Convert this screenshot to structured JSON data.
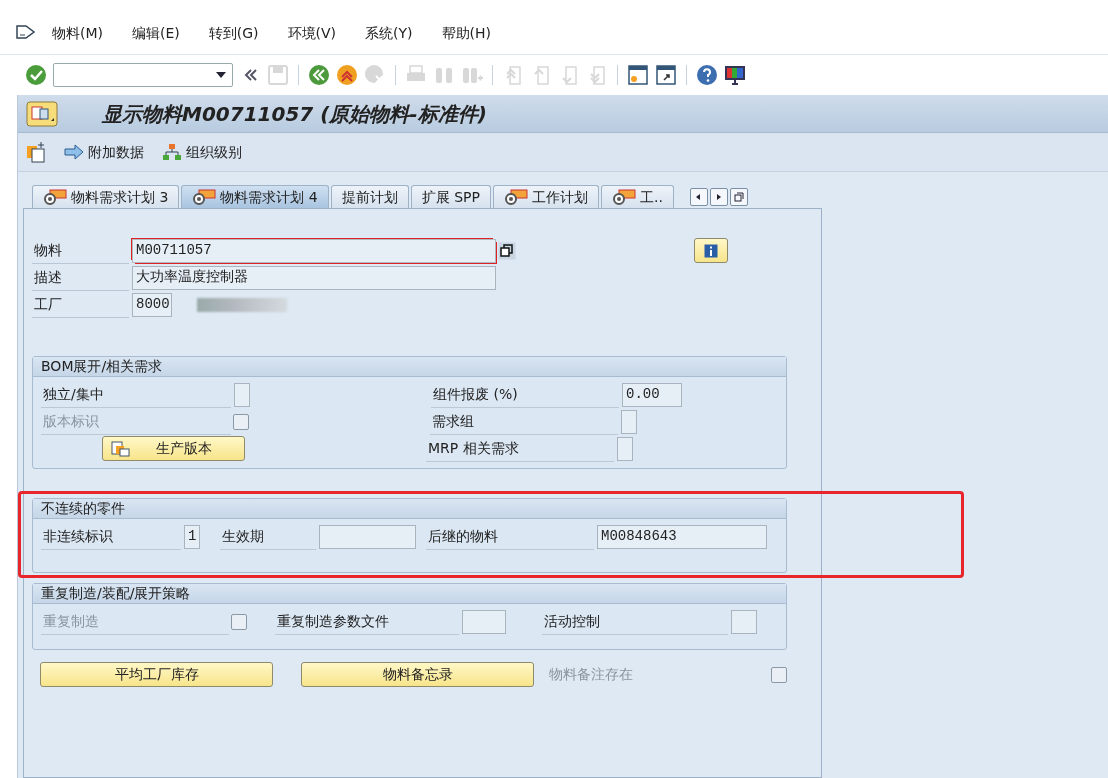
{
  "menu": [
    "物料(M)",
    "编辑(E)",
    "转到(G)",
    "环境(V)",
    "系统(Y)",
    "帮助(H)"
  ],
  "toolbar_groups": [
    [
      {
        "kind": "enter",
        "disabled": false
      },
      {
        "kind": "command-field",
        "disabled": false
      },
      {
        "kind": "collapse",
        "disabled": false
      },
      {
        "kind": "save",
        "disabled": true
      }
    ],
    [
      {
        "kind": "back",
        "disabled": false
      },
      {
        "kind": "exit",
        "disabled": false
      },
      {
        "kind": "cancel",
        "disabled": true
      }
    ],
    [
      {
        "kind": "print",
        "disabled": true
      },
      {
        "kind": "find",
        "disabled": true
      },
      {
        "kind": "find-next",
        "disabled": true
      }
    ],
    [
      {
        "kind": "first-page",
        "disabled": true
      },
      {
        "kind": "prev-page",
        "disabled": true
      },
      {
        "kind": "next-page",
        "disabled": true
      },
      {
        "kind": "last-page",
        "disabled": true
      }
    ],
    [
      {
        "kind": "new-session",
        "disabled": false
      },
      {
        "kind": "shortcut",
        "disabled": false
      }
    ],
    [
      {
        "kind": "help",
        "disabled": false
      },
      {
        "kind": "layout",
        "disabled": false
      }
    ]
  ],
  "title": "显示物料M00711057 (原始物料-标准件)",
  "app_toolbar": [
    {
      "kind": "create-doc"
    },
    {
      "kind": "arrow",
      "label": "附加数据"
    },
    {
      "kind": "org",
      "label": "组织级别"
    }
  ],
  "tabs": [
    {
      "label": "物料需求计划 3",
      "selected": false,
      "has_icon": true
    },
    {
      "label": "物料需求计划 4",
      "selected": true,
      "has_icon": true
    },
    {
      "label": "提前计划",
      "selected": false,
      "has_icon": false
    },
    {
      "label": "扩展 SPP",
      "selected": false,
      "has_icon": false
    },
    {
      "label": "工作计划",
      "selected": false,
      "has_icon": true
    },
    {
      "label": "工..",
      "selected": false,
      "has_icon": true
    }
  ],
  "header_fields": [
    {
      "label": "物料",
      "value": "M00711057",
      "required": true
    },
    {
      "label": "描述",
      "value": "大功率温度控制器",
      "required": false
    },
    {
      "label": "工厂",
      "value": "8000",
      "required": false
    }
  ],
  "groups": [
    {
      "title": "BOM展开/相关需求",
      "highlight": false,
      "rows": [
        [
          {
            "kind": "field",
            "label": "独立/集中",
            "disabled": false
          },
          {
            "kind": "field",
            "label": "组件报废 (%)",
            "value": "0.00",
            "disabled": false
          }
        ],
        [
          {
            "kind": "checkbox",
            "label": "版本标识",
            "checked": false,
            "disabled": true
          },
          {
            "kind": "field",
            "label": "需求组",
            "disabled": false
          }
        ],
        [
          {
            "kind": "button",
            "label": "生产版本"
          },
          {
            "kind": "field",
            "label": "MRP 相关需求",
            "disabled": false
          }
        ]
      ]
    },
    {
      "title": "不连续的零件",
      "highlight": true,
      "rows": [
        [
          {
            "kind": "field",
            "label": "非连续标识",
            "value": "1",
            "disabled": false
          },
          {
            "kind": "field",
            "label": "生效期",
            "disabled": false
          },
          {
            "kind": "field",
            "label": "后继的物料",
            "value": "M00848643",
            "disabled": false
          }
        ]
      ]
    },
    {
      "title": "重复制造/装配/展开策略",
      "highlight": false,
      "rows": [
        [
          {
            "kind": "checkbox",
            "label": "重复制造",
            "checked": false,
            "disabled": true
          },
          {
            "kind": "field",
            "label": "重复制造参数文件",
            "disabled": false
          },
          {
            "kind": "field",
            "label": "活动控制",
            "disabled": false
          }
        ]
      ]
    }
  ],
  "bottom": [
    {
      "kind": "button",
      "label": "平均工厂库存"
    },
    {
      "kind": "button",
      "label": "物料备忘录"
    },
    {
      "kind": "checkbox",
      "label": "物料备注存在",
      "checked": false,
      "disabled": true
    }
  ]
}
